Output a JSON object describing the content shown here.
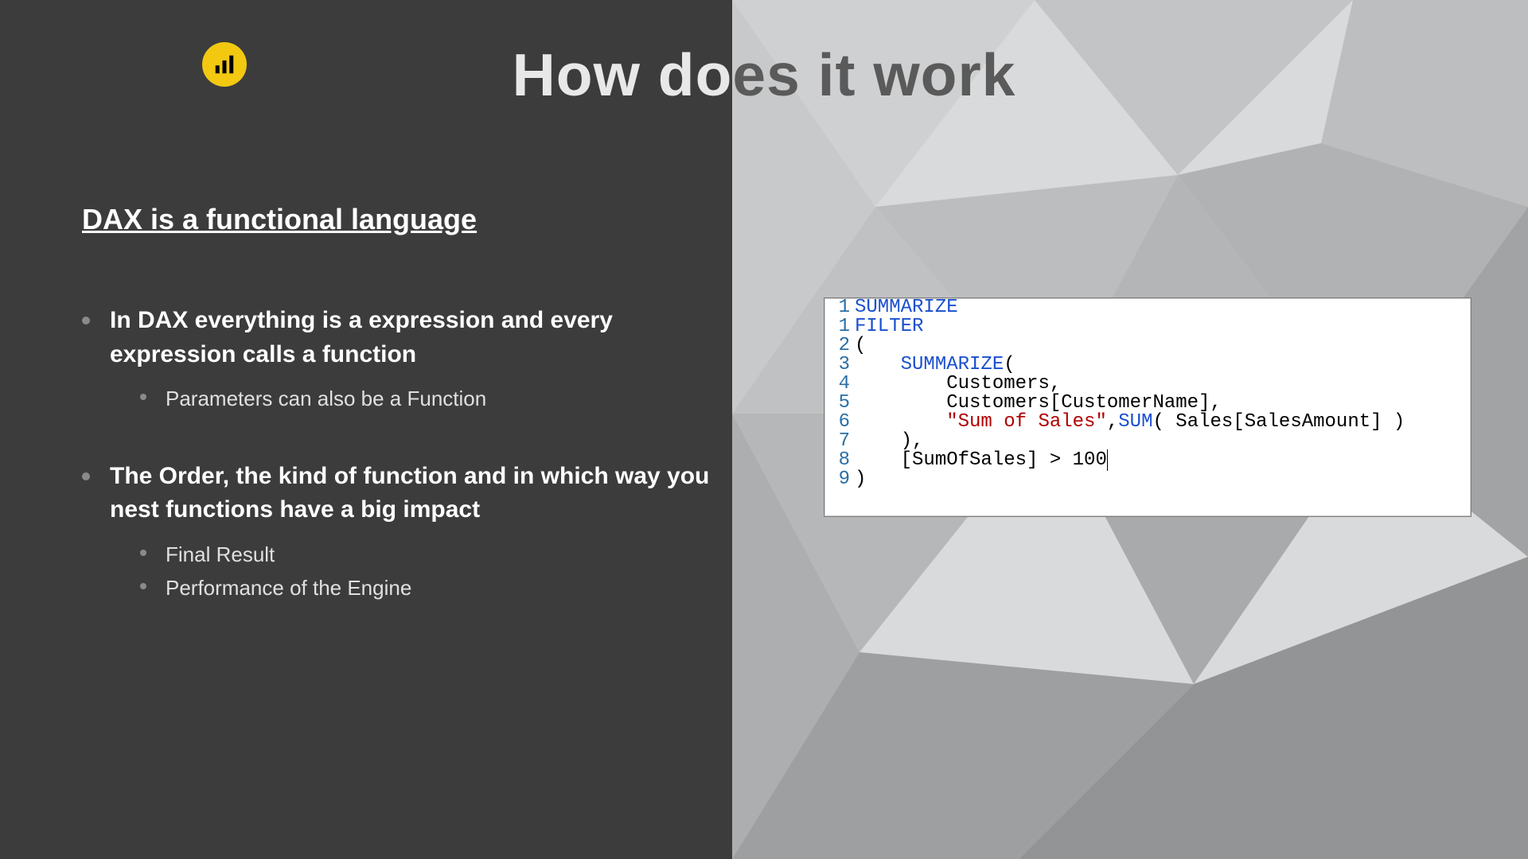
{
  "title_left": "How do",
  "title_right": "es it work",
  "subtitle": "DAX is a functional language",
  "bullets": [
    {
      "text": "In DAX everything is a expression and every expression calls a function",
      "sub": [
        "Parameters can also be a Function"
      ]
    },
    {
      "text": "The Order, the kind of function and in which way you nest functions have a big impact",
      "sub": [
        "Final Result",
        "Performance of the Engine"
      ]
    }
  ],
  "code": {
    "gutter": [
      "1",
      "1",
      "2",
      "3",
      "4",
      "5",
      "6",
      "7",
      "8",
      "9"
    ],
    "lines": [
      [
        {
          "t": "SUMMARIZE",
          "c": "kw"
        }
      ],
      [
        {
          "t": "FILTER",
          "c": "kw"
        }
      ],
      [
        {
          "t": "("
        }
      ],
      [
        {
          "t": "    "
        },
        {
          "t": "SUMMARIZE",
          "c": "kw"
        },
        {
          "t": "("
        }
      ],
      [
        {
          "t": "        Customers,"
        }
      ],
      [
        {
          "t": "        Customers[CustomerName],"
        }
      ],
      [
        {
          "t": "        "
        },
        {
          "t": "\"Sum of Sales\"",
          "c": "str"
        },
        {
          "t": ","
        },
        {
          "t": "SUM",
          "c": "kw"
        },
        {
          "t": "( Sales[SalesAmount] )"
        }
      ],
      [
        {
          "t": "    ),"
        }
      ],
      [
        {
          "t": "    [SumOfSales] > 100",
          "cur": true
        }
      ],
      [
        {
          "t": ")"
        }
      ]
    ]
  },
  "logo_name": "power-bi-logo"
}
